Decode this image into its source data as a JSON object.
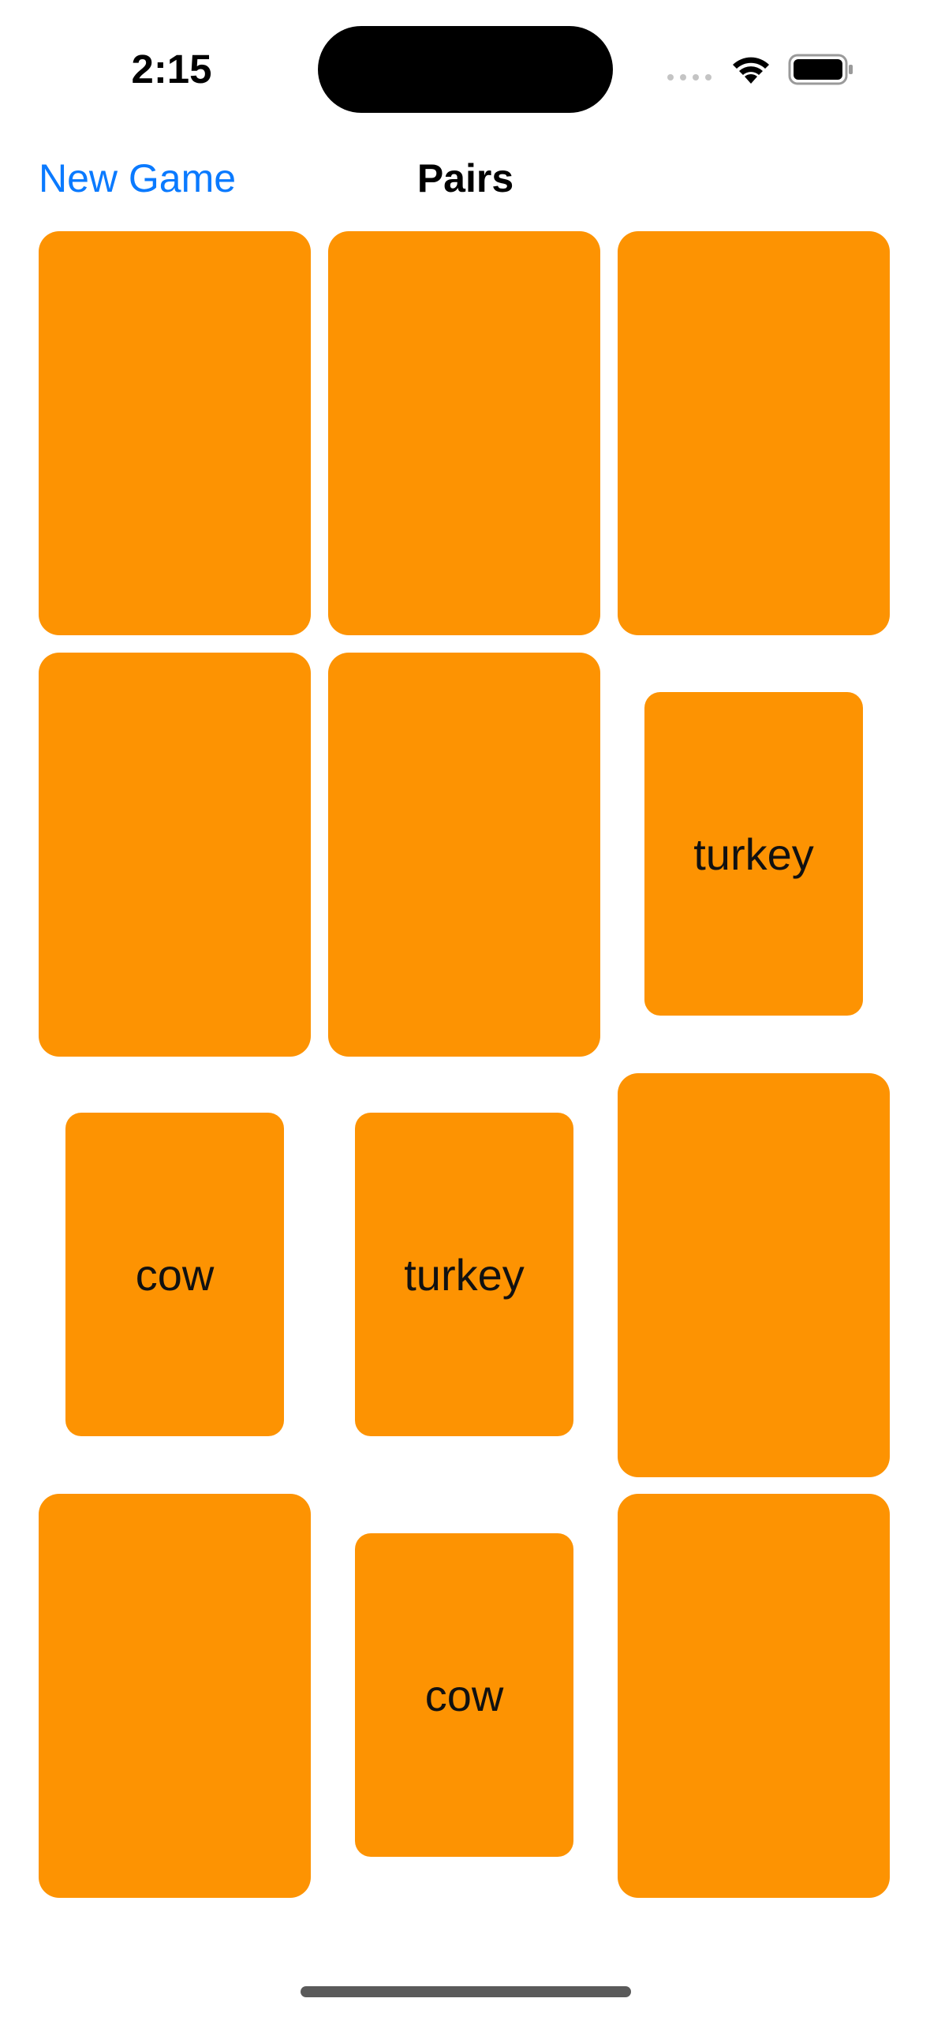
{
  "status_bar": {
    "time": "2:15"
  },
  "nav": {
    "new_game_label": "New Game",
    "title": "Pairs"
  },
  "cards": [
    {
      "state": "face-down",
      "label": ""
    },
    {
      "state": "face-down",
      "label": ""
    },
    {
      "state": "face-down",
      "label": ""
    },
    {
      "state": "face-down",
      "label": ""
    },
    {
      "state": "face-down",
      "label": ""
    },
    {
      "state": "face-up",
      "label": "turkey"
    },
    {
      "state": "face-up",
      "label": "cow"
    },
    {
      "state": "face-up",
      "label": "turkey"
    },
    {
      "state": "face-down",
      "label": ""
    },
    {
      "state": "face-down",
      "label": ""
    },
    {
      "state": "face-up",
      "label": "cow"
    },
    {
      "state": "face-down",
      "label": ""
    }
  ],
  "colors": {
    "card": "#fd9302",
    "accent": "#0a7aff",
    "background": "#ffffff"
  }
}
